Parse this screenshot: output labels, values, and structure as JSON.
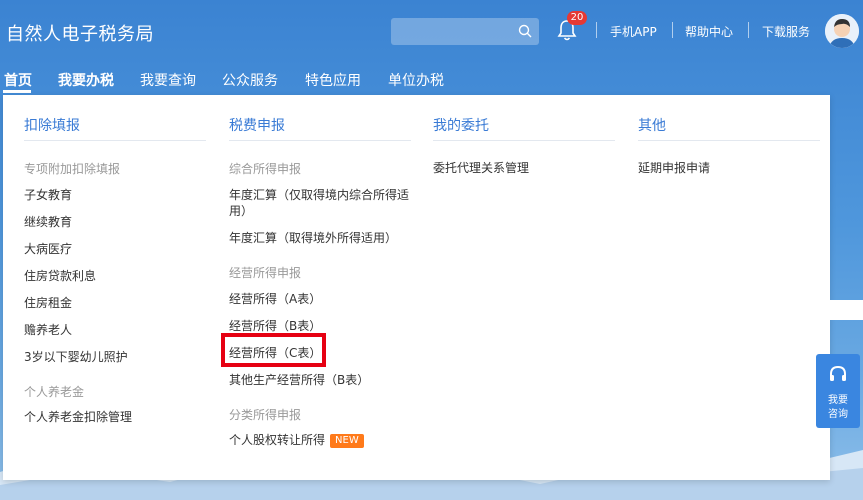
{
  "header": {
    "title": "自然人电子税务局",
    "search": {
      "placeholder": "",
      "value": ""
    },
    "notification_count": "20",
    "links": [
      "手机APP",
      "帮助中心",
      "下载服务"
    ]
  },
  "nav": {
    "items": [
      "首页",
      "我要办税",
      "我要查询",
      "公众服务",
      "特色应用",
      "单位办税"
    ],
    "active": "首页"
  },
  "dropdown": {
    "columns": [
      {
        "title": "扣除填报",
        "groups": [
          {
            "label": "专项附加扣除填报",
            "items": [
              "子女教育",
              "继续教育",
              "大病医疗",
              "住房贷款利息",
              "住房租金",
              "赡养老人",
              "3岁以下婴幼儿照护"
            ]
          },
          {
            "label": "个人养老金",
            "items": [
              "个人养老金扣除管理"
            ]
          }
        ]
      },
      {
        "title": "税费申报",
        "groups": [
          {
            "label": "综合所得申报",
            "items": [
              "年度汇算（仅取得境内综合所得适用）",
              "年度汇算（取得境外所得适用）"
            ]
          },
          {
            "label": "经营所得申报",
            "items": [
              "经营所得（A表）",
              "经营所得（B表）",
              "经营所得（C表）",
              "其他生产经营所得（B表）"
            ]
          },
          {
            "label": "分类所得申报",
            "items": [
              "个人股权转让所得"
            ]
          }
        ],
        "new_badge": "NEW"
      },
      {
        "title": "我的委托",
        "groups": [
          {
            "items": [
              "委托代理关系管理"
            ]
          }
        ]
      },
      {
        "title": "其他",
        "groups": [
          {
            "items": [
              "延期申报申请"
            ]
          }
        ]
      }
    ]
  },
  "float_help": {
    "line1": "我要",
    "line2": "咨询"
  },
  "colors": {
    "accent": "#3a7bd5",
    "highlight": "#e60012",
    "new": "#ff7a1a"
  }
}
